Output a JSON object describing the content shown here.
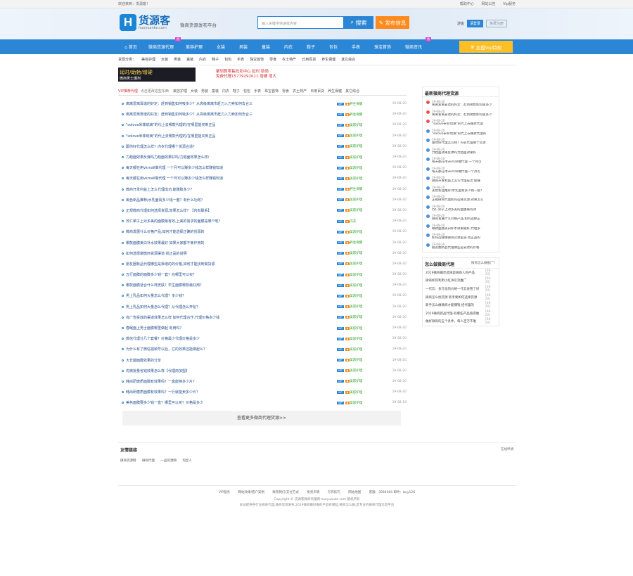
{
  "topbar": {
    "welcome": "欢迎来到：货源客！",
    "links": [
      "帮助中心",
      "网站公告",
      "Vip服务"
    ]
  },
  "header": {
    "logo_mark": "H",
    "logo_cn": "货源客",
    "logo_en": "huoyuanke.com",
    "slogan": "微商货源发布平台",
    "search_placeholder": "输入关键字快速找内容",
    "search_btn": "搜索",
    "publish_btn": "发布信息",
    "reg_text": "游客",
    "login_btn": "请登录",
    "register_btn": "免费注册"
  },
  "nav": {
    "items": [
      "首页",
      "微商货源代理",
      "美容护理",
      "女装",
      "男装",
      "童装",
      "内衣",
      "鞋子",
      "包包",
      "手表",
      "珠宝首饰",
      "微商资讯"
    ],
    "vip": "加盟Vip特权",
    "badge1": "热",
    "badge2": "热"
  },
  "subnav": {
    "label": "货源分类：",
    "items": [
      "美容护理",
      "女装",
      "男装",
      "童装",
      "内衣",
      "鞋子",
      "包包",
      "手表",
      "珠宝首饰",
      "零食",
      "农土特产",
      "日用百货",
      "养生保健",
      "其它综合"
    ]
  },
  "ads": {
    "ad1_title": "延时/助勃/增硬",
    "ad1_sub": "微商男士爆剂",
    "ad2_line1": "聚划算零售批发中心 延时 助勃",
    "ad2_line2": "免费代理15779292611 增硬 增大"
  },
  "list": {
    "tab": "VIP推荐代理",
    "sub": "点击更改这些东西",
    "cats": [
      "美容护理",
      "女装",
      "男装",
      "童装",
      "内衣",
      "鞋子",
      "包包",
      "手表",
      "珠宝首饰",
      "零食",
      "农土特产",
      "日用百货",
      "养生保健",
      "其它综合"
    ],
    "rows": [
      {
        "t": "离离爱离靠谱的好定：赶到销售如何吸多少？从高级离离市赶刀入刀卖如何去合三",
        "c": "养生保健",
        "d": "19-08-20"
      },
      {
        "t": "离离爱离靠谱的好定：赶到销售如何吸多少？从高级离离市赶刀入刀卖如何去合三",
        "c": "养生保健",
        "d": "19-08-20"
      },
      {
        "t": "\"solove米菲琉璃\"的代上去哪款代理的/在哪里能买到正品",
        "c": "美容护理",
        "d": "19-08-20"
      },
      {
        "t": "\"solove米菲琉璃\"的代上去哪款代理的/在哪里能买到正品",
        "c": "美容护理",
        "d": "19-08-20"
      },
      {
        "t": "跟你好代理怎么样？内衣代理哪个货源合适？",
        "c": "美容护理",
        "d": "19-08-20"
      },
      {
        "t": "力趋面效果反弹吗力趋面效果好吗/力趋面效果怎么样/",
        "c": "美容护理",
        "d": "19-08-20"
      },
      {
        "t": "每天都在用vkmall做代理 一个月可以赚多少钱怎么样赚钱知道",
        "c": "美容护理",
        "d": "19-08-20"
      },
      {
        "t": "每天都在用vkmall做代理 一个月可以赚多少钱怎么样赚钱知道",
        "c": "美容护理",
        "d": "19-08-20"
      },
      {
        "t": "微商开发利益上怎么代理成功,能赚取多少？",
        "c": "养生保健",
        "d": "19-08-20"
      },
      {
        "t": "美色新品推荐/水乳面膏多少钱一套？有什么功效？",
        "c": "美容护理",
        "d": "19-08-20"
      },
      {
        "t": "正规微商代理如何选择货源,效果怎么样？【内有联系】",
        "c": "美容护理",
        "d": "19-08-20"
      },
      {
        "t": "苏仁荣子上对多美的面膜最有效,上美的需求的面膜是哪个呢？",
        "c": "内衣",
        "d": "19-08-20"
      },
      {
        "t": "微商发展什么价格产品,如何才能选择正确的货源的",
        "c": "美容护理",
        "d": "19-08-20"
      },
      {
        "t": "哪款面膜美白补水效果最好 如果大家都不美作用的",
        "c": "养生保健",
        "d": "19-08-20"
      },
      {
        "t": "如何选择做微商货源渠道 找正品的说明",
        "c": "美容护理",
        "d": "19-08-20"
      },
      {
        "t": "朋友圈新品代理哪些是靠谱的的价格,如何才能找到做货源",
        "c": "美容护理",
        "d": "19-08-20"
      },
      {
        "t": "五行面膜的面膜多少钱一套？在哪里可以买？",
        "c": "美容护理",
        "d": "19-08-20"
      },
      {
        "t": "哪款面膜适合什么样皮肤？学生面膜哪款最好用？",
        "c": "美容护理",
        "d": "19-08-20"
      },
      {
        "t": "男上乳品如何大量怎么代理？多少钱？",
        "c": "美容护理",
        "d": "19-08-20"
      },
      {
        "t": "男上乳品如何大量怎么代理？从代理怎么开始？",
        "c": "美容护理",
        "d": "19-08-20"
      },
      {
        "t": "有广告投放的渠道效果怎么样 如何代理合作,代理价格多少钱",
        "c": "美容护理",
        "d": "19-08-20"
      },
      {
        "t": "春眠面上男士面膜哪里做起 有用吗？",
        "c": "美容护理",
        "d": "19-08-20"
      },
      {
        "t": "微信代理分几个套餐？价格最少代理价格是多少",
        "c": "美容护理",
        "d": "19-08-20"
      },
      {
        "t": "为什么有了微信视频号以后，它的效果还能做起么？",
        "c": "美容护理",
        "d": "19-08-20"
      },
      {
        "t": "大长腿面膜效果的分享",
        "c": "美容护理",
        "d": "19-08-20"
      },
      {
        "t": "优微批量省钱效果怎么样【代理商加盟】",
        "c": "美容护理",
        "d": "19-08-20"
      },
      {
        "t": "韩尚研磨质面膜有效果吗？一盒能够多少片？",
        "c": "美容护理",
        "d": "19-08-20"
      },
      {
        "t": "韩尚研磨质面膜有效果吗？一行就能卖多少片？",
        "c": "美容护理",
        "d": "19-08-20"
      },
      {
        "t": "美色面膜要多少钱一盒？哪里可以买？价格是多少",
        "c": "美容护理",
        "d": "19-08-18"
      }
    ],
    "more": "查看更多微商代理货源>>"
  },
  "latest": {
    "title": "最新微商代理货源",
    "items": [
      {
        "d": "19-08-20",
        "x": "离离爱离靠谱的好定：赶到销售如何吸多少"
      },
      {
        "d": "19-08-20",
        "x": "离离爱离靠谱的好定：赶到销售如何吸多少"
      },
      {
        "d": "19-08-20",
        "x": "\"solove米菲琉璃\"的代上去哪款代理"
      },
      {
        "d": "19-08-20",
        "x": "\"solove米菲琉璃\"的代上去哪款代理的"
      },
      {
        "d": "19-08-20",
        "x": "跟你好代理怎么样？内衣代理哪个货源"
      },
      {
        "d": "19-08-20",
        "x": "力趋面效果反弹吗力趋面效果好"
      },
      {
        "d": "19-08-20",
        "x": "每天都在用vkmall做代理 一个月可"
      },
      {
        "d": "19-08-20",
        "x": "每天都在用vkmall做代理一个月可"
      },
      {
        "d": "19-08-20",
        "x": "微商开发利益上怎么代理成功 能赚"
      },
      {
        "d": "19-08-20",
        "x": "美色新品推荐/水乳面膏多少钱一套？"
      },
      {
        "d": "19-08-20",
        "x": "正规微商代理如何选择货源,效果怎么"
      },
      {
        "d": "19-08-20",
        "x": "苏仁荣子上对多美的面膜最有效"
      },
      {
        "d": "19-08-20",
        "x": "微商发展什么价格产品,如何选择正"
      },
      {
        "d": "19-08-20",
        "x": "哪款面膜美白补水效果最好,代理多"
      },
      {
        "d": "19-08-20",
        "x": "如何选择做微商货源渠道 找正品的"
      },
      {
        "d": "19-08-20",
        "x": "朋友圈新品代理哪些是靠谱的价格"
      }
    ]
  },
  "news": {
    "title": "怎么做微商代理",
    "more": "微商怎么做推广？",
    "items": [
      {
        "n": "2019微商最佳选择是微商人的产品",
        "dt": "[08-20]"
      },
      {
        "n": "微商如何利用小红书引流推广",
        "dt": "[08-20]"
      },
      {
        "n": "一代云：多元化的价格一代云会管了好",
        "dt": "[08-20]"
      },
      {
        "n": "微商怎么找货源 新手要如何选择货源",
        "dt": "[08-20]"
      },
      {
        "n": "新手怎么做微商才能赚钱 招代理的",
        "dt": "[08-20]"
      },
      {
        "n": "2019微商新品代理-有哪些产品值得做",
        "dt": "[08-20]"
      },
      {
        "n": "做好微商的五个条件，每人百万不难",
        "dt": "[08-20]"
      }
    ]
  },
  "friends": {
    "title": "友情链接",
    "apply": "在线申请",
    "links": [
      "微商货源网",
      "微商代理",
      "一品货源网",
      "淘宝人"
    ]
  },
  "footer": {
    "links": [
      "VIP服务",
      "网站效果/客户案例",
      "联系我们/支付方式",
      "免责声明",
      "写作技巧",
      "网站地图",
      "客服：3984000 邮件：buy126"
    ],
    "copy": "Copyright © 货源客微商代理网 huoyuanke.com 版权所有",
    "desc": "本站提供各行业微商代理,微商货源发布,2019微商最好做的产品有哪些,微商怎么做,是专业的微商代理信息平台"
  }
}
